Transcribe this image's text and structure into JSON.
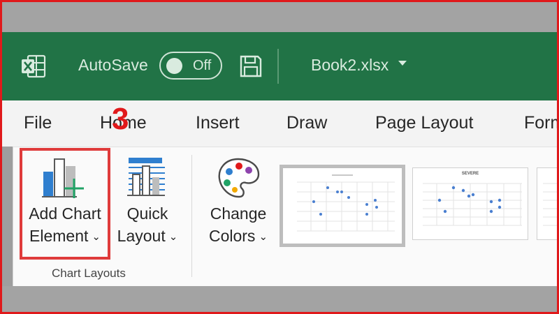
{
  "titlebar": {
    "autosave_label": "AutoSave",
    "toggle_state": "Off",
    "filename": "Book2.xlsx",
    "bg_color": "#217346"
  },
  "menu": {
    "tabs": [
      "File",
      "Home",
      "Insert",
      "Draw",
      "Page Layout",
      "Form"
    ]
  },
  "annotation": {
    "step_number": "3",
    "color": "#e0191b"
  },
  "ribbon": {
    "add_chart_element": {
      "line1": "Add Chart",
      "line2": "Element",
      "chevron": "⌄"
    },
    "quick_layout": {
      "line1": "Quick",
      "line2": "Layout",
      "chevron": "⌄"
    },
    "change_colors": {
      "line1": "Change",
      "line2": "Colors",
      "chevron": "⌄"
    },
    "group_label": "Chart Layouts",
    "chart_style_2_title": "SEVERE"
  }
}
